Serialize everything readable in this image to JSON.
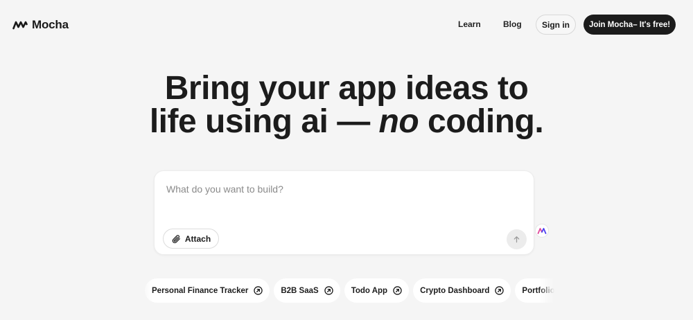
{
  "header": {
    "logo_text": "Mocha",
    "nav": [
      {
        "label": "Learn"
      },
      {
        "label": "Blog"
      }
    ],
    "signin_label": "Sign in",
    "join_label": "Join Mocha– It's free!"
  },
  "hero": {
    "line1": "Bring your app ideas to",
    "line2_start": "life using ai —",
    "line2_emphasis": "no",
    "line2_end": "coding."
  },
  "prompt": {
    "placeholder": "What do you want to build?",
    "attach_label": "Attach"
  },
  "suggestions": [
    {
      "label": "Personal Finance Tracker"
    },
    {
      "label": "B2B SaaS"
    },
    {
      "label": "Todo App"
    },
    {
      "label": "Crypto Dashboard"
    },
    {
      "label": "Portfolio Website"
    }
  ],
  "colors": {
    "background": "#f5f5f5",
    "primary_button": "#1c1c1c",
    "mascot_pink": "#e0489a",
    "mascot_blue": "#4a3ff0"
  },
  "icons": {
    "logo": "mocha-logo-icon",
    "attach": "paperclip-icon",
    "send": "arrow-up-icon",
    "chip": "arrow-up-right-circle-icon",
    "mascot": "mocha-mascot-icon"
  }
}
